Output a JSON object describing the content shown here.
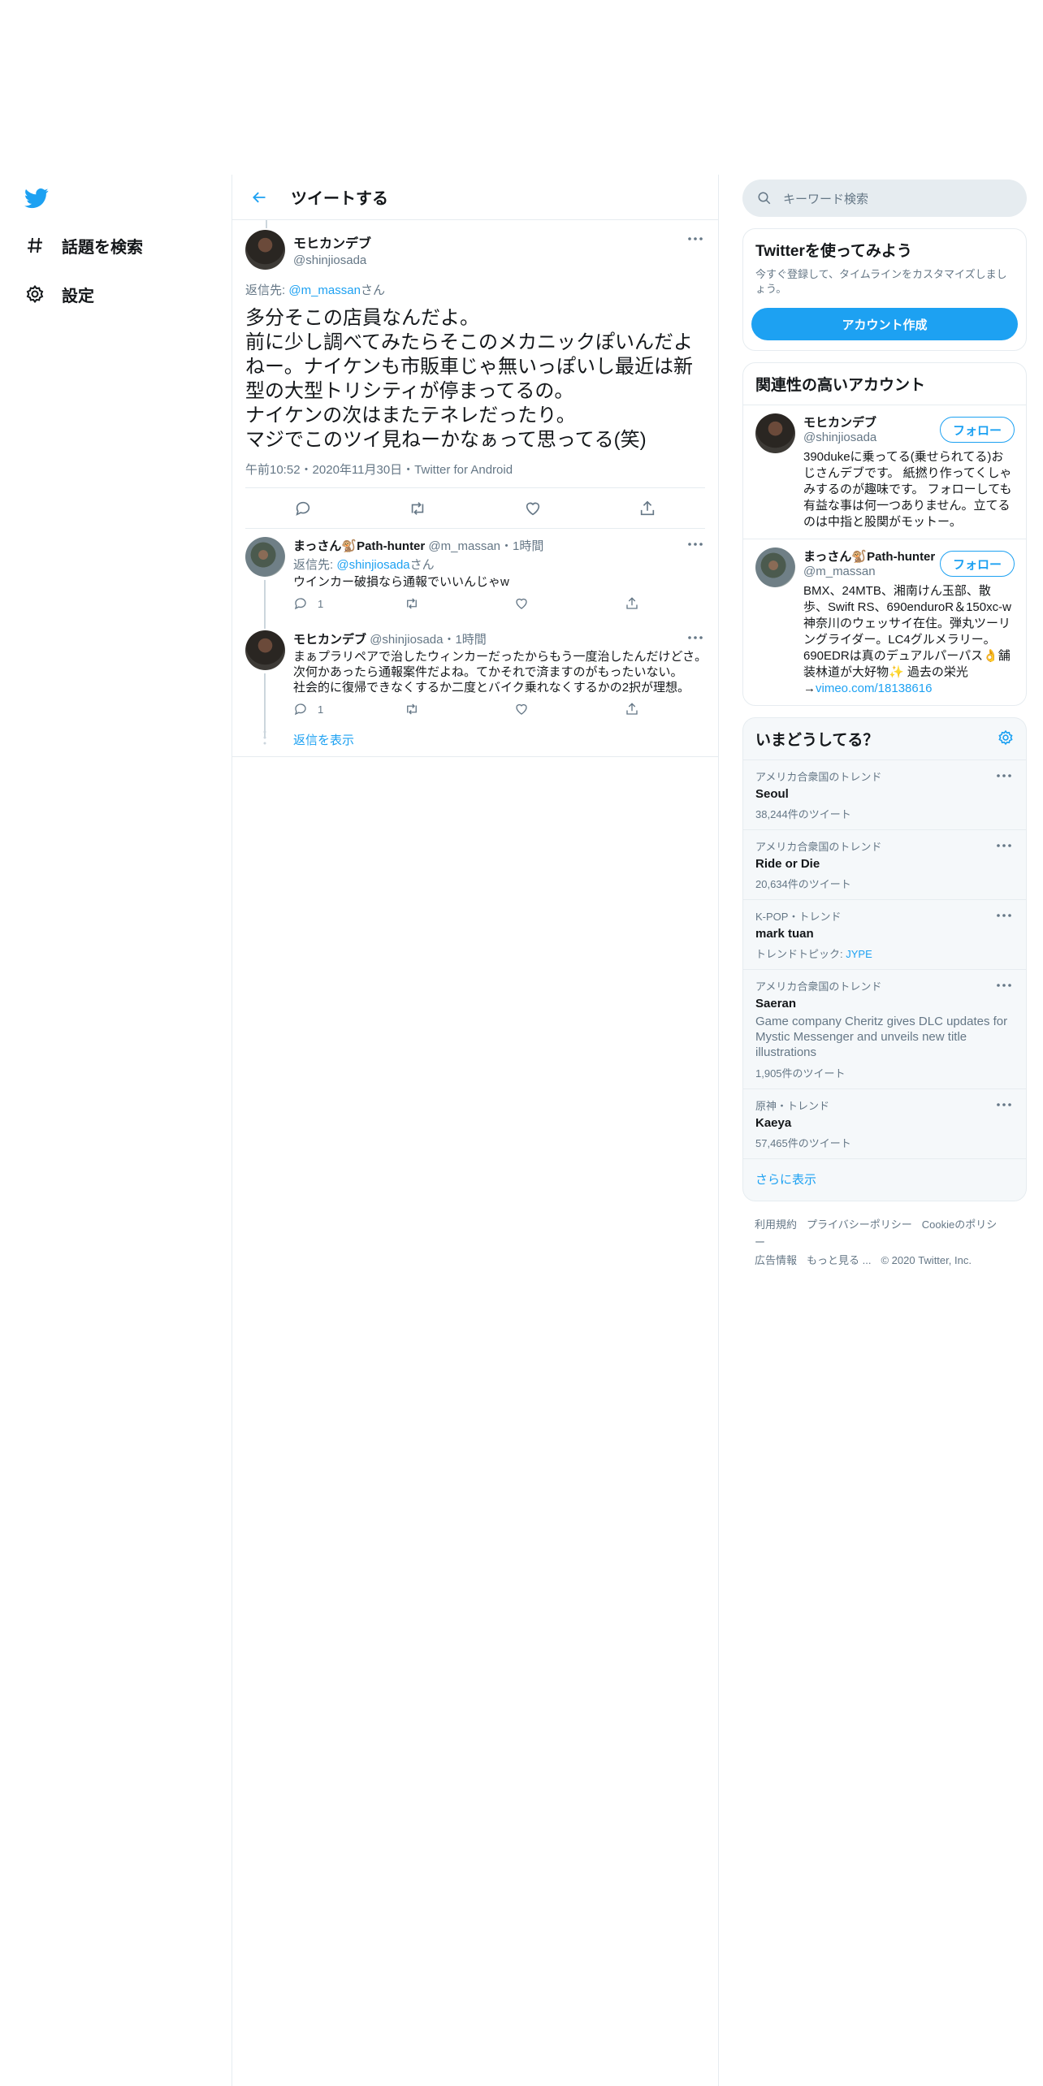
{
  "nav": {
    "explore_label": "話題を検索",
    "settings_label": "設定"
  },
  "header": {
    "title": "ツイートする"
  },
  "main_tweet": {
    "name": "モヒカンデブ",
    "handle": "@shinjiosada",
    "replying_prefix": "返信先: ",
    "replying_to": "@m_massan",
    "replying_suffix": "さん",
    "text": "多分そこの店員なんだよ。\n前に少し調べてみたらそこのメカニックぽいんだよねー。ナイケンも市販車じゃ無いっぽいし最近は新型の大型トリシティが停まってるの。\nナイケンの次はまたテネレだったり。\nマジでこのツイ見ねーかなぁって思ってる(笑)",
    "meta": "午前10:52・2020年11月30日・Twitter for Android"
  },
  "replies": [
    {
      "name": "まっさん🐒Path-hunter",
      "handle": "@m_massan",
      "time": "・1時間",
      "replying_prefix": "返信先: ",
      "replying_to": "@shinjiosada",
      "replying_suffix": "さん",
      "text": "ウインカー破損なら通報でいいんじゃw",
      "reply_count": "1"
    },
    {
      "name": "モヒカンデブ",
      "handle": "@shinjiosada",
      "time": "・1時間",
      "text": "まぁプラリペアで治したウィンカーだったからもう一度治したんだけどさ。\n次何かあったら通報案件だよね。てかそれで済ますのがもったいない。\n社会的に復帰できなくするか二度とバイク乗れなくするかの2択が理想。",
      "reply_count": "1"
    }
  ],
  "show_replies": "返信を表示",
  "right": {
    "search_placeholder": "キーワード検索",
    "signup": {
      "title": "Twitterを使ってみよう",
      "text": "今すぐ登録して、タイムラインをカスタマイズしましょう。",
      "button": "アカウント作成"
    },
    "who_to_follow": {
      "title": "関連性の高いアカウント",
      "follow_label": "フォロー",
      "accounts": [
        {
          "name": "モヒカンデブ",
          "handle": "@shinjiosada",
          "bio": "390dukeに乗ってる(乗せられてる)おじさんデブです。 紙撚り作ってくしゃみするのが趣味です。 フォローしても有益な事は何一つありません。立てるのは中指と股関がモットー。"
        },
        {
          "name": "まっさん🐒Path-hunter",
          "handle": "@m_massan",
          "bio": "BMX、24MTB、湘南けん玉部、散歩、Swift RS、690enduroR＆150xc-w 神奈川のウェッサイ在住。弾丸ツーリングライダー。LC4グルメラリー。690EDRは真のデュアルパーパス👌舗装林道が大好物✨ 過去の栄光→",
          "link": "vimeo.com/18138616"
        }
      ]
    },
    "trends": {
      "title": "いまどうしてる？",
      "items": [
        {
          "context": "アメリカ合衆国のトレンド",
          "name": "Seoul",
          "count": "38,244件のツイート"
        },
        {
          "context": "アメリカ合衆国のトレンド",
          "name": "Ride or Die",
          "count": "20,634件のツイート"
        },
        {
          "context": "K-POP・トレンド",
          "name": "mark tuan",
          "topic_prefix": "トレンドトピック: ",
          "topic": "JYPE"
        },
        {
          "context": "アメリカ合衆国のトレンド",
          "name": "Saeran",
          "desc": "Game company Cheritz gives DLC updates for Mystic Messenger and unveils new title illustrations",
          "count": "1,905件のツイート"
        },
        {
          "context": "原神・トレンド",
          "name": "Kaeya",
          "count": "57,465件のツイート"
        }
      ],
      "show_more": "さらに表示"
    },
    "footer": {
      "terms": "利用規約",
      "privacy": "プライバシーポリシー",
      "cookies": "Cookieのポリシー",
      "ads": "広告情報",
      "more": "もっと見る ...",
      "copyright": "© 2020 Twitter, Inc."
    }
  },
  "colors": {
    "accent": "#1da1f2",
    "secondary_text": "#657786",
    "border": "#e6ecf0"
  }
}
